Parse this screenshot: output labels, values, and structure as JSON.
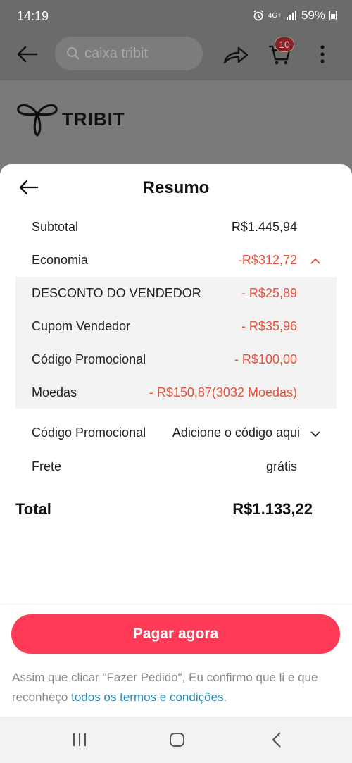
{
  "status_bar": {
    "time": "14:19",
    "network": "4G+",
    "battery": "59%"
  },
  "header": {
    "search_text": "caixa tribit",
    "cart_count": "10"
  },
  "brand": {
    "name": "TRIBIT"
  },
  "summary": {
    "title": "Resumo",
    "subtotal_label": "Subtotal",
    "subtotal_value": "R$1.445,94",
    "savings_label": "Economia",
    "savings_value": "-R$312,72",
    "discounts": [
      {
        "label": "DESCONTO DO VENDEDOR",
        "value": "- R$25,89"
      },
      {
        "label": "Cupom Vendedor",
        "value": "- R$35,96"
      },
      {
        "label": "Código Promocional",
        "value": "- R$100,00"
      },
      {
        "label": "Moedas",
        "value": "- R$150,87(3032 Moedas)"
      }
    ],
    "promo_label": "Código Promocional",
    "promo_value": "Adicione o código aqui",
    "shipping_label": "Frete",
    "shipping_value": "grátis",
    "total_label": "Total",
    "total_value": "R$1.133,22"
  },
  "actions": {
    "pay_label": "Pagar agora",
    "terms_text": "Assim que clicar \"Fazer Pedido\", Eu confirmo que li e que reconheço ",
    "terms_link": "todos os termos e condições",
    "terms_end": "."
  },
  "colors": {
    "accent": "#fe3a56",
    "discount_red": "#e8503a",
    "link": "#2a8ab5"
  }
}
